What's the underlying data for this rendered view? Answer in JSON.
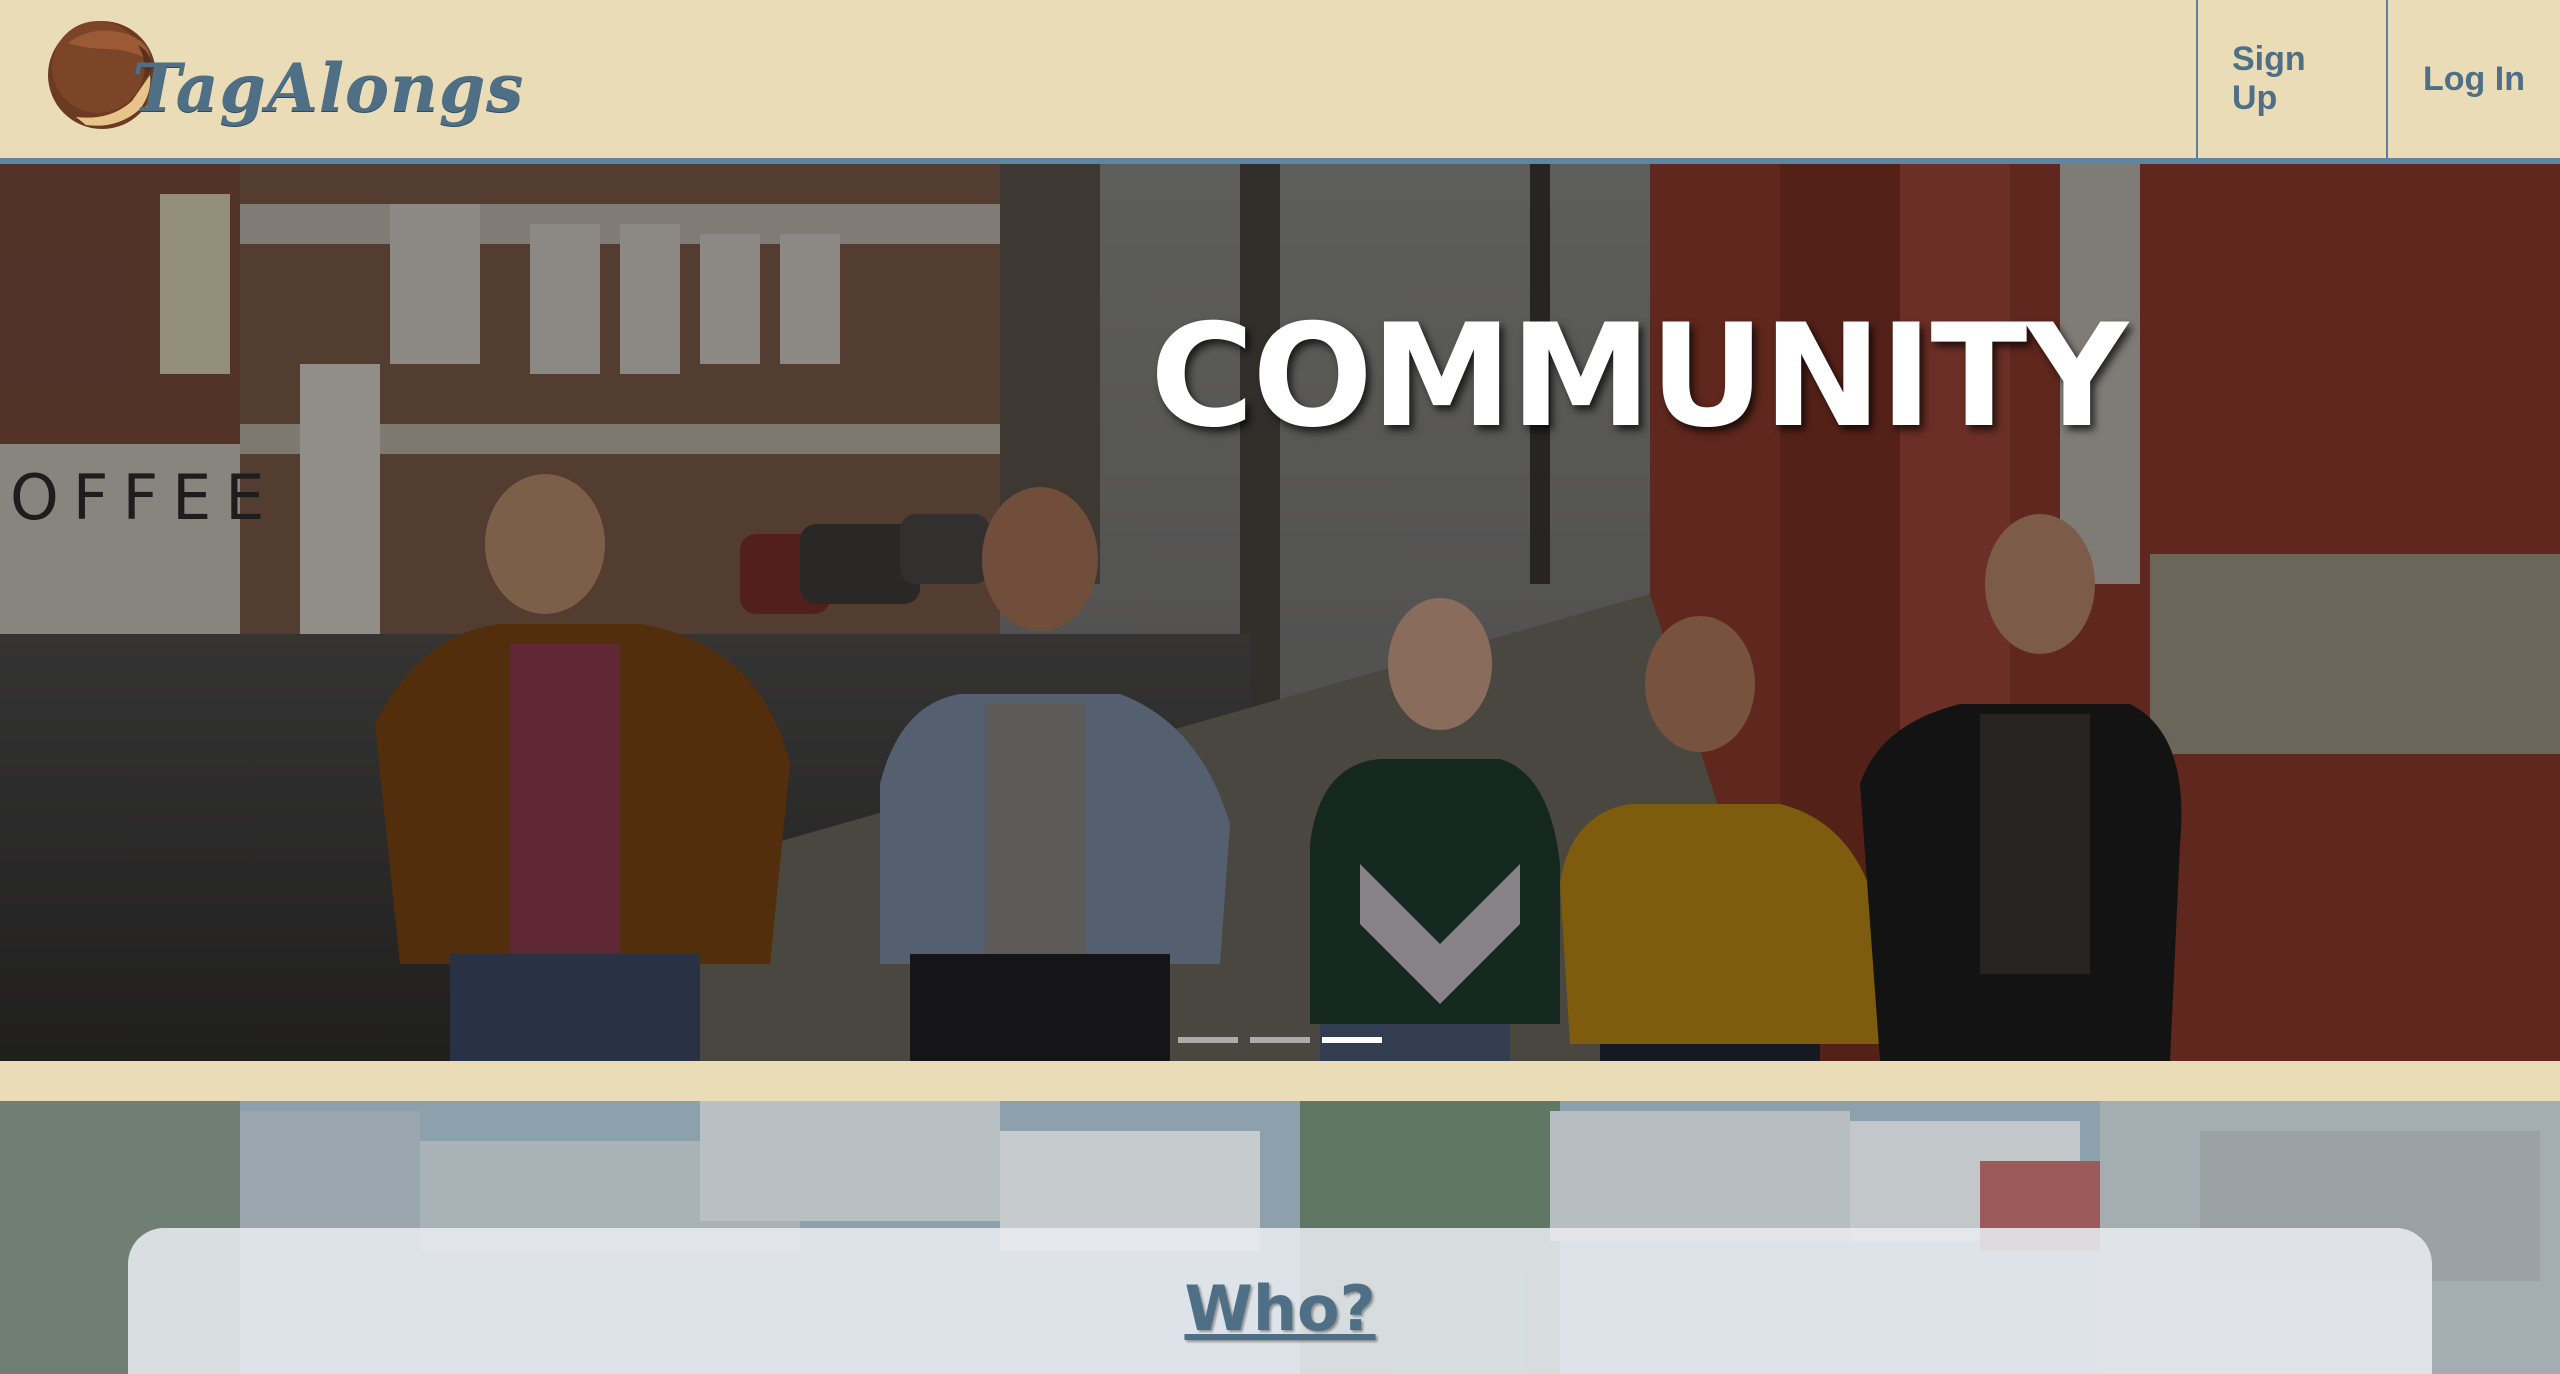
{
  "brand": {
    "name": "TagAlongs",
    "logo_icon": "cookie-icon"
  },
  "nav": {
    "signup_label": "Sign Up",
    "login_label": "Log In"
  },
  "hero": {
    "title": "COMMUNITY",
    "storefront_sign": "OFFEE",
    "slides": 3,
    "active_slide": 3
  },
  "section": {
    "heading": "Who?"
  },
  "colors": {
    "beige": "#e9dcb6",
    "brand_blue": "#4f6f86",
    "accent_blue": "#5e86a3"
  }
}
